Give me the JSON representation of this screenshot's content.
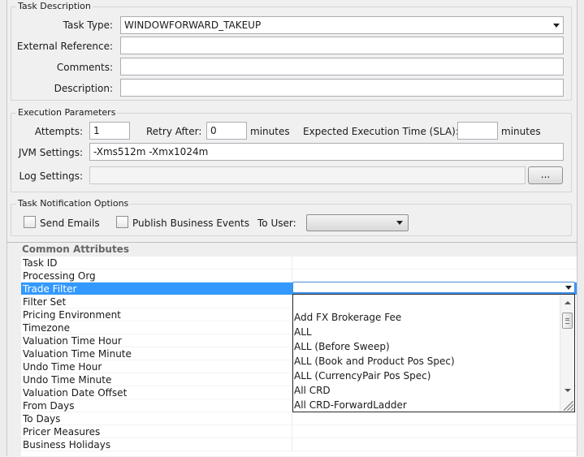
{
  "task_description": {
    "legend": "Task Description",
    "task_type_label": "Task Type:",
    "task_type_value": "WINDOWFORWARD_TAKEUP",
    "external_reference_label": "External Reference:",
    "external_reference_value": "",
    "comments_label": "Comments:",
    "comments_value": "",
    "description_label": "Description:",
    "description_value": ""
  },
  "execution_parameters": {
    "legend": "Execution Parameters",
    "attempts_label": "Attempts:",
    "attempts_value": "1",
    "retry_after_label": "Retry After:",
    "retry_after_value": "0",
    "retry_units": "minutes",
    "sla_label": "Expected Execution Time (SLA):",
    "sla_value": "",
    "sla_units": "minutes",
    "jvm_label": "JVM Settings:",
    "jvm_value": "-Xms512m -Xmx1024m",
    "log_label": "Log Settings:",
    "log_value": "",
    "browse_label": "..."
  },
  "notification": {
    "legend": "Task Notification Options",
    "send_emails_label": "Send Emails",
    "send_emails_checked": false,
    "publish_label": "Publish Business Events",
    "publish_checked": false,
    "to_user_label": "To User:",
    "to_user_value": ""
  },
  "properties": {
    "category": "Common Attributes",
    "rows": [
      {
        "name": "Task ID",
        "value": ""
      },
      {
        "name": "Processing Org",
        "value": ""
      },
      {
        "name": "Trade Filter",
        "value": "",
        "selected": true
      },
      {
        "name": "Filter Set",
        "value": ""
      },
      {
        "name": "Pricing Environment",
        "value": ""
      },
      {
        "name": "Timezone",
        "value": ""
      },
      {
        "name": "Valuation Time Hour",
        "value": ""
      },
      {
        "name": "Valuation Time Minute",
        "value": ""
      },
      {
        "name": "Undo Time Hour",
        "value": ""
      },
      {
        "name": "Undo Time Minute",
        "value": ""
      },
      {
        "name": "Valuation Date Offset",
        "value": ""
      },
      {
        "name": "From Days",
        "value": ""
      },
      {
        "name": "To Days",
        "value": ""
      },
      {
        "name": "Pricer Measures",
        "value": ""
      },
      {
        "name": "Business Holidays",
        "value": ""
      }
    ]
  },
  "trade_filter_dropdown": {
    "current_value": "",
    "options": [
      "",
      "Add FX Brokerage Fee",
      "ALL",
      "ALL (Before Sweep)",
      "ALL (Book and Product Pos Spec)",
      "ALL (CurrencyPair Pos Spec)",
      "All CRD",
      "All CRD-ForwardLadder"
    ]
  },
  "icons": {
    "combo_arrow": "chevron-down-icon",
    "collapse": "minus-box-icon",
    "scroll_up": "scroll-up-arrow-icon",
    "scroll_down": "scroll-down-arrow-icon",
    "resize": "resize-grip-icon"
  },
  "colors": {
    "selection": "#3399ff",
    "background": "#f0f0f0"
  }
}
